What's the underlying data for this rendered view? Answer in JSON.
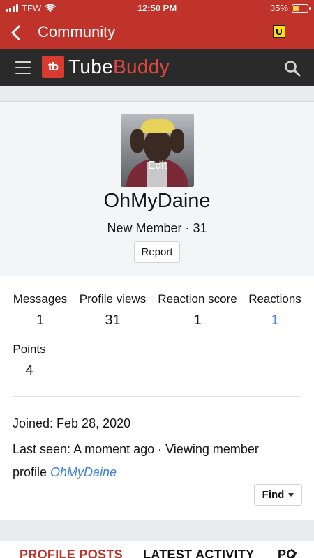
{
  "status_bar": {
    "carrier": "TFW",
    "time": "12:50 PM",
    "battery": "35%"
  },
  "app_bar": {
    "title": "Community",
    "extension_badge": "U"
  },
  "site_header": {
    "logo_mark": "tb",
    "logo_word_1": "Tube",
    "logo_word_2": "Buddy"
  },
  "profile": {
    "avatar_edit_label": "Edit",
    "username": "OhMyDaine",
    "member_line": "New Member · 31",
    "report_label": "Report"
  },
  "stats": [
    {
      "label": "Messages",
      "value": "1"
    },
    {
      "label": "Profile views",
      "value": "31"
    },
    {
      "label": "Reaction score",
      "value": "1"
    },
    {
      "label": "Reactions",
      "value": "1"
    },
    {
      "label": "Points",
      "value": "4"
    }
  ],
  "info": {
    "joined": "Joined: Feb 28, 2020",
    "last_seen_prefix": "Last seen: A moment ago · Viewing member",
    "last_seen_line2": "profile",
    "last_seen_link": "OhMyDaine",
    "find_label": "Find"
  },
  "tabs": [
    {
      "label": "PROFILE POSTS"
    },
    {
      "label": "LATEST ACTIVITY"
    },
    {
      "label": "PO"
    }
  ],
  "colors": {
    "brand_red": "#c0332b",
    "header_dark": "#2a2a2a",
    "link_blue": "#3b82d9"
  }
}
